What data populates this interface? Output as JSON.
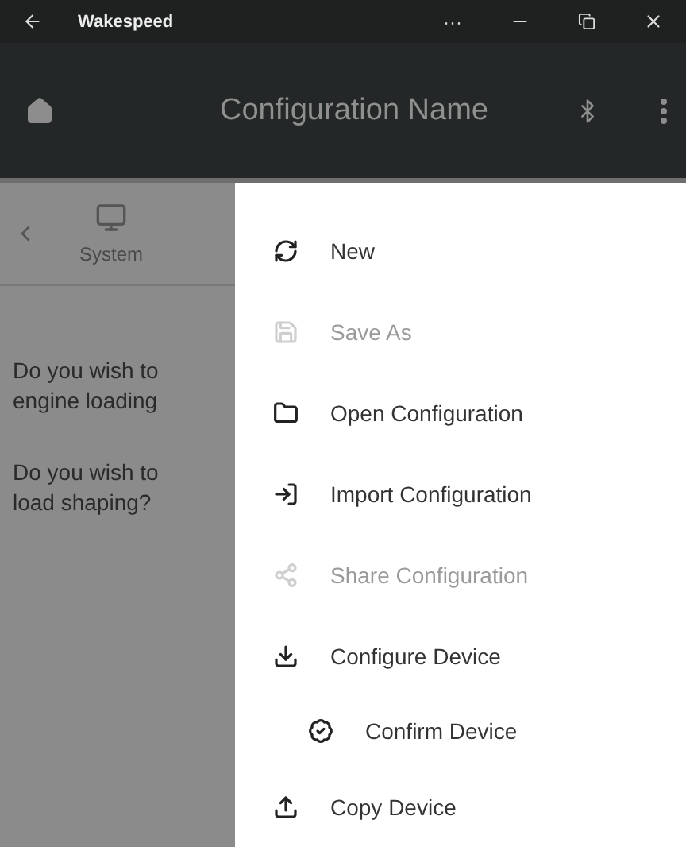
{
  "window": {
    "title": "Wakespeed",
    "more": "···"
  },
  "app_bar": {
    "title": "Configuration Name"
  },
  "section_tab": {
    "label": "System"
  },
  "questions": [
    {
      "lines": [
        "Do you wish to",
        "engine loading"
      ]
    },
    {
      "lines": [
        "Do you wish to",
        "load shaping?"
      ]
    }
  ],
  "menu": [
    {
      "kind": "new",
      "label": "New",
      "disabled": false
    },
    {
      "kind": "save",
      "label": "Save As",
      "disabled": true
    },
    {
      "kind": "open",
      "label": "Open Configuration",
      "disabled": false
    },
    {
      "kind": "import",
      "label": "Import Configuration",
      "disabled": false
    },
    {
      "kind": "share",
      "label": "Share Configuration",
      "disabled": true
    },
    {
      "kind": "download",
      "label": "Configure Device",
      "disabled": false,
      "children": [
        {
          "kind": "confirm",
          "label": "Confirm Device",
          "disabled": false
        }
      ]
    },
    {
      "kind": "upload",
      "label": "Copy Device",
      "disabled": false
    }
  ]
}
